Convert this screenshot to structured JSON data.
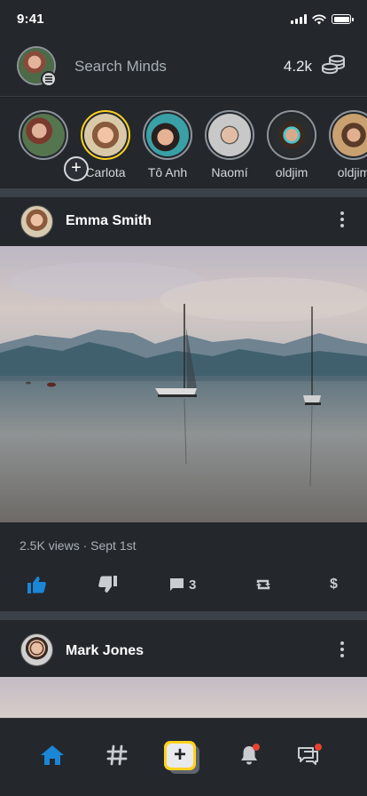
{
  "status_bar": {
    "time": "9:41"
  },
  "top_bar": {
    "search_placeholder": "Search Minds",
    "token_balance": "4.2k"
  },
  "stories": [
    {
      "name": "",
      "kind": "own"
    },
    {
      "name": "Carlota",
      "active": true
    },
    {
      "name": "Tô Anh"
    },
    {
      "name": "Naomí"
    },
    {
      "name": "oldjim"
    },
    {
      "name": "oldjim"
    }
  ],
  "posts": [
    {
      "author": "Emma Smith",
      "views": "2.5K views",
      "date": "Sept 1st",
      "meta": "2.5K views · Sept 1st",
      "comments": "3"
    },
    {
      "author": "Mark Jones"
    }
  ],
  "actions": {
    "tip_symbol": "$"
  },
  "bottom_nav": {
    "compose_symbol": "+"
  },
  "colors": {
    "accent_blue": "#1b85d6",
    "accent_yellow": "#ffd21f",
    "notification_red": "#e5432f",
    "background": "#24282d"
  }
}
